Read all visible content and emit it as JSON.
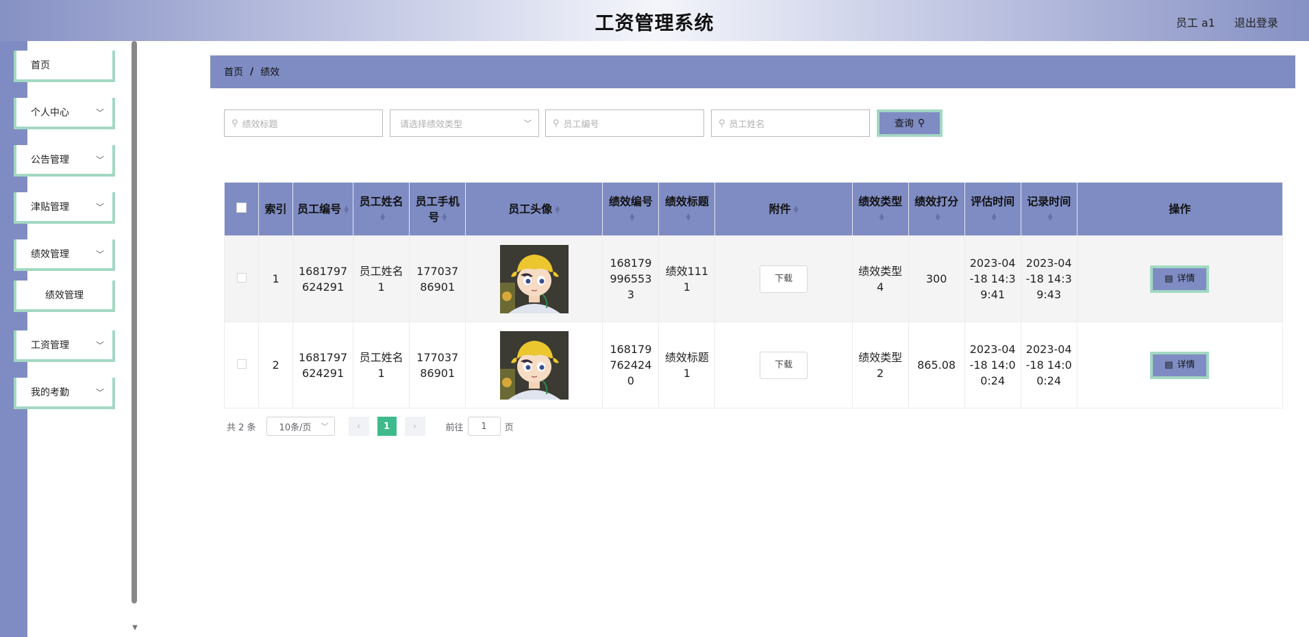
{
  "header": {
    "title": "工资管理系统",
    "user": "员工 a1",
    "logout": "退出登录"
  },
  "sidebar": {
    "items": [
      {
        "label": "首页",
        "has_arrow": false
      },
      {
        "label": "个人中心",
        "has_arrow": true
      },
      {
        "label": "公告管理",
        "has_arrow": true
      },
      {
        "label": "津贴管理",
        "has_arrow": true
      },
      {
        "label": "绩效管理",
        "has_arrow": true,
        "expanded": true,
        "children": [
          {
            "label": "绩效管理"
          }
        ]
      },
      {
        "label": "工资管理",
        "has_arrow": true
      },
      {
        "label": "我的考勤",
        "has_arrow": true
      }
    ]
  },
  "breadcrumb": {
    "home": "首页",
    "separator": "/",
    "current": "绩效"
  },
  "search": {
    "title_placeholder": "绩效标题",
    "type_placeholder": "请选择绩效类型",
    "emp_no_placeholder": "员工编号",
    "emp_name_placeholder": "员工姓名",
    "query_label": "查询"
  },
  "table": {
    "headers": {
      "index": "索引",
      "emp_no": "员工编号",
      "emp_name": "员工姓名",
      "emp_phone": "员工手机号",
      "avatar": "员工头像",
      "perf_no": "绩效编号",
      "perf_title": "绩效标题",
      "attachment": "附件",
      "perf_type": "绩效类型",
      "score": "绩效打分",
      "eval_time": "评估时间",
      "record_time": "记录时间",
      "actions": "操作"
    },
    "rows": [
      {
        "index": "1",
        "emp_no": "1681797624291",
        "emp_name": "员工姓名1",
        "emp_phone": "17703786901",
        "perf_no": "1681799965533",
        "perf_title": "绩效1111",
        "attachment": "下载",
        "perf_type": "绩效类型4",
        "score": "300",
        "eval_time": "2023-04-18 14:39:41",
        "record_time": "2023-04-18 14:39:43",
        "action": "详情"
      },
      {
        "index": "2",
        "emp_no": "1681797624291",
        "emp_name": "员工姓名1",
        "emp_phone": "17703786901",
        "perf_no": "1681797624240",
        "perf_title": "绩效标题1",
        "attachment": "下载",
        "perf_type": "绩效类型2",
        "score": "865.08",
        "eval_time": "2023-04-18 14:00:24",
        "record_time": "2023-04-18 14:00:24",
        "action": "详情"
      }
    ]
  },
  "pagination": {
    "total": "共 2 条",
    "page_size": "10条/页",
    "current": "1",
    "goto_prefix": "前往",
    "goto_value": "1",
    "goto_suffix": "页"
  },
  "icons": {
    "search": "search-icon",
    "chevron": "chevron-down-icon",
    "sort": "sort-icon",
    "document": "document-icon"
  },
  "colors": {
    "primary": "#7f8cc3",
    "accent_border": "#a2d8c2",
    "page_active": "#3fba8c"
  }
}
